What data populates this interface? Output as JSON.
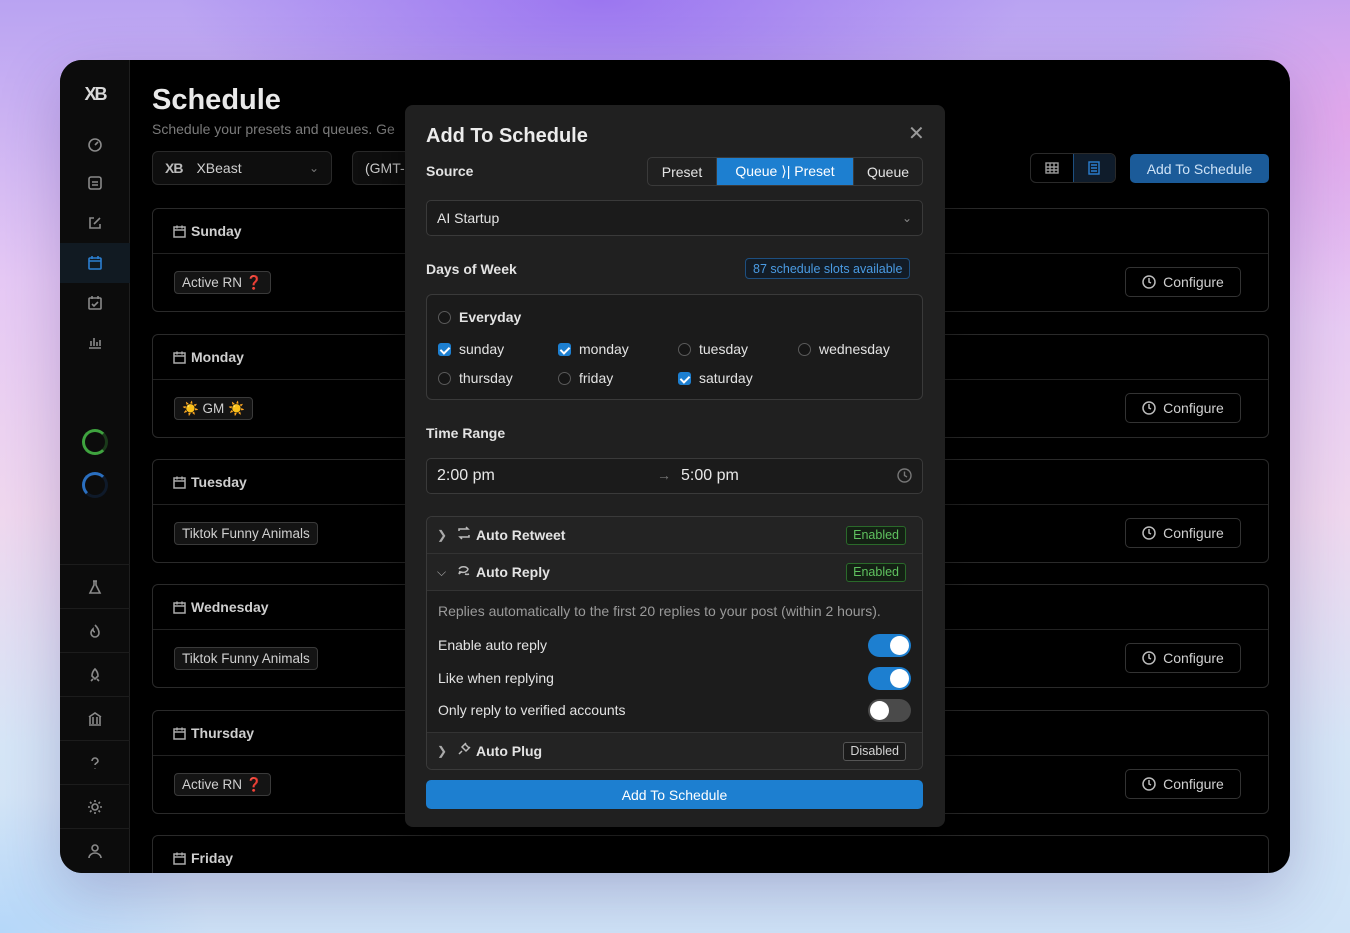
{
  "app": {
    "logo": "XB"
  },
  "page": {
    "title": "Schedule",
    "subtitle": "Schedule your presets and queues. Ge",
    "account": "XBeast",
    "account_logo": "XB",
    "timezone": "(GMT-",
    "add_button": "Add To Schedule"
  },
  "days": [
    {
      "name": "Sunday",
      "chip": "Active RN ❓",
      "configure": "Configure"
    },
    {
      "name": "Monday",
      "chip": "☀️ GM ☀️",
      "configure": "Configure"
    },
    {
      "name": "Tuesday",
      "chip": "Tiktok Funny Animals",
      "configure": "Configure"
    },
    {
      "name": "Wednesday",
      "chip": "Tiktok Funny Animals",
      "configure": "Configure"
    },
    {
      "name": "Thursday",
      "chip": "Active RN ❓",
      "configure": "Configure"
    },
    {
      "name": "Friday"
    }
  ],
  "modal": {
    "title": "Add To Schedule",
    "close": "✕",
    "source_label": "Source",
    "source_tabs": [
      "Preset",
      "Queue ⟩| Preset",
      "Queue"
    ],
    "source_selected_index": 1,
    "source_value": "AI Startup",
    "days_label": "Days of Week",
    "slots_badge": "87 schedule slots available",
    "everyday": {
      "label": "Everyday",
      "checked": false
    },
    "weekdays": [
      {
        "label": "sunday",
        "checked": true
      },
      {
        "label": "monday",
        "checked": true
      },
      {
        "label": "tuesday",
        "checked": false
      },
      {
        "label": "wednesday",
        "checked": false
      },
      {
        "label": "thursday",
        "checked": false
      },
      {
        "label": "friday",
        "checked": false
      },
      {
        "label": "saturday",
        "checked": true
      }
    ],
    "time_label": "Time Range",
    "time_start": "2:00 pm",
    "time_arrow": "→",
    "time_end": "5:00 pm",
    "auto_retweet": {
      "title": "Auto Retweet",
      "status": "Enabled"
    },
    "auto_reply": {
      "title": "Auto Reply",
      "status": "Enabled",
      "description": "Replies automatically to the first 20 replies to your post (within 2 hours).",
      "options": [
        {
          "label": "Enable auto reply",
          "on": true
        },
        {
          "label": "Like when replying",
          "on": true
        },
        {
          "label": "Only reply to verified accounts",
          "on": false
        }
      ]
    },
    "auto_plug": {
      "title": "Auto Plug",
      "status": "Disabled"
    },
    "submit": "Add To Schedule"
  },
  "colors": {
    "accent": "#1d7fd0",
    "enabled": "#5fc15f",
    "badge_blue": "#4a9be3"
  }
}
